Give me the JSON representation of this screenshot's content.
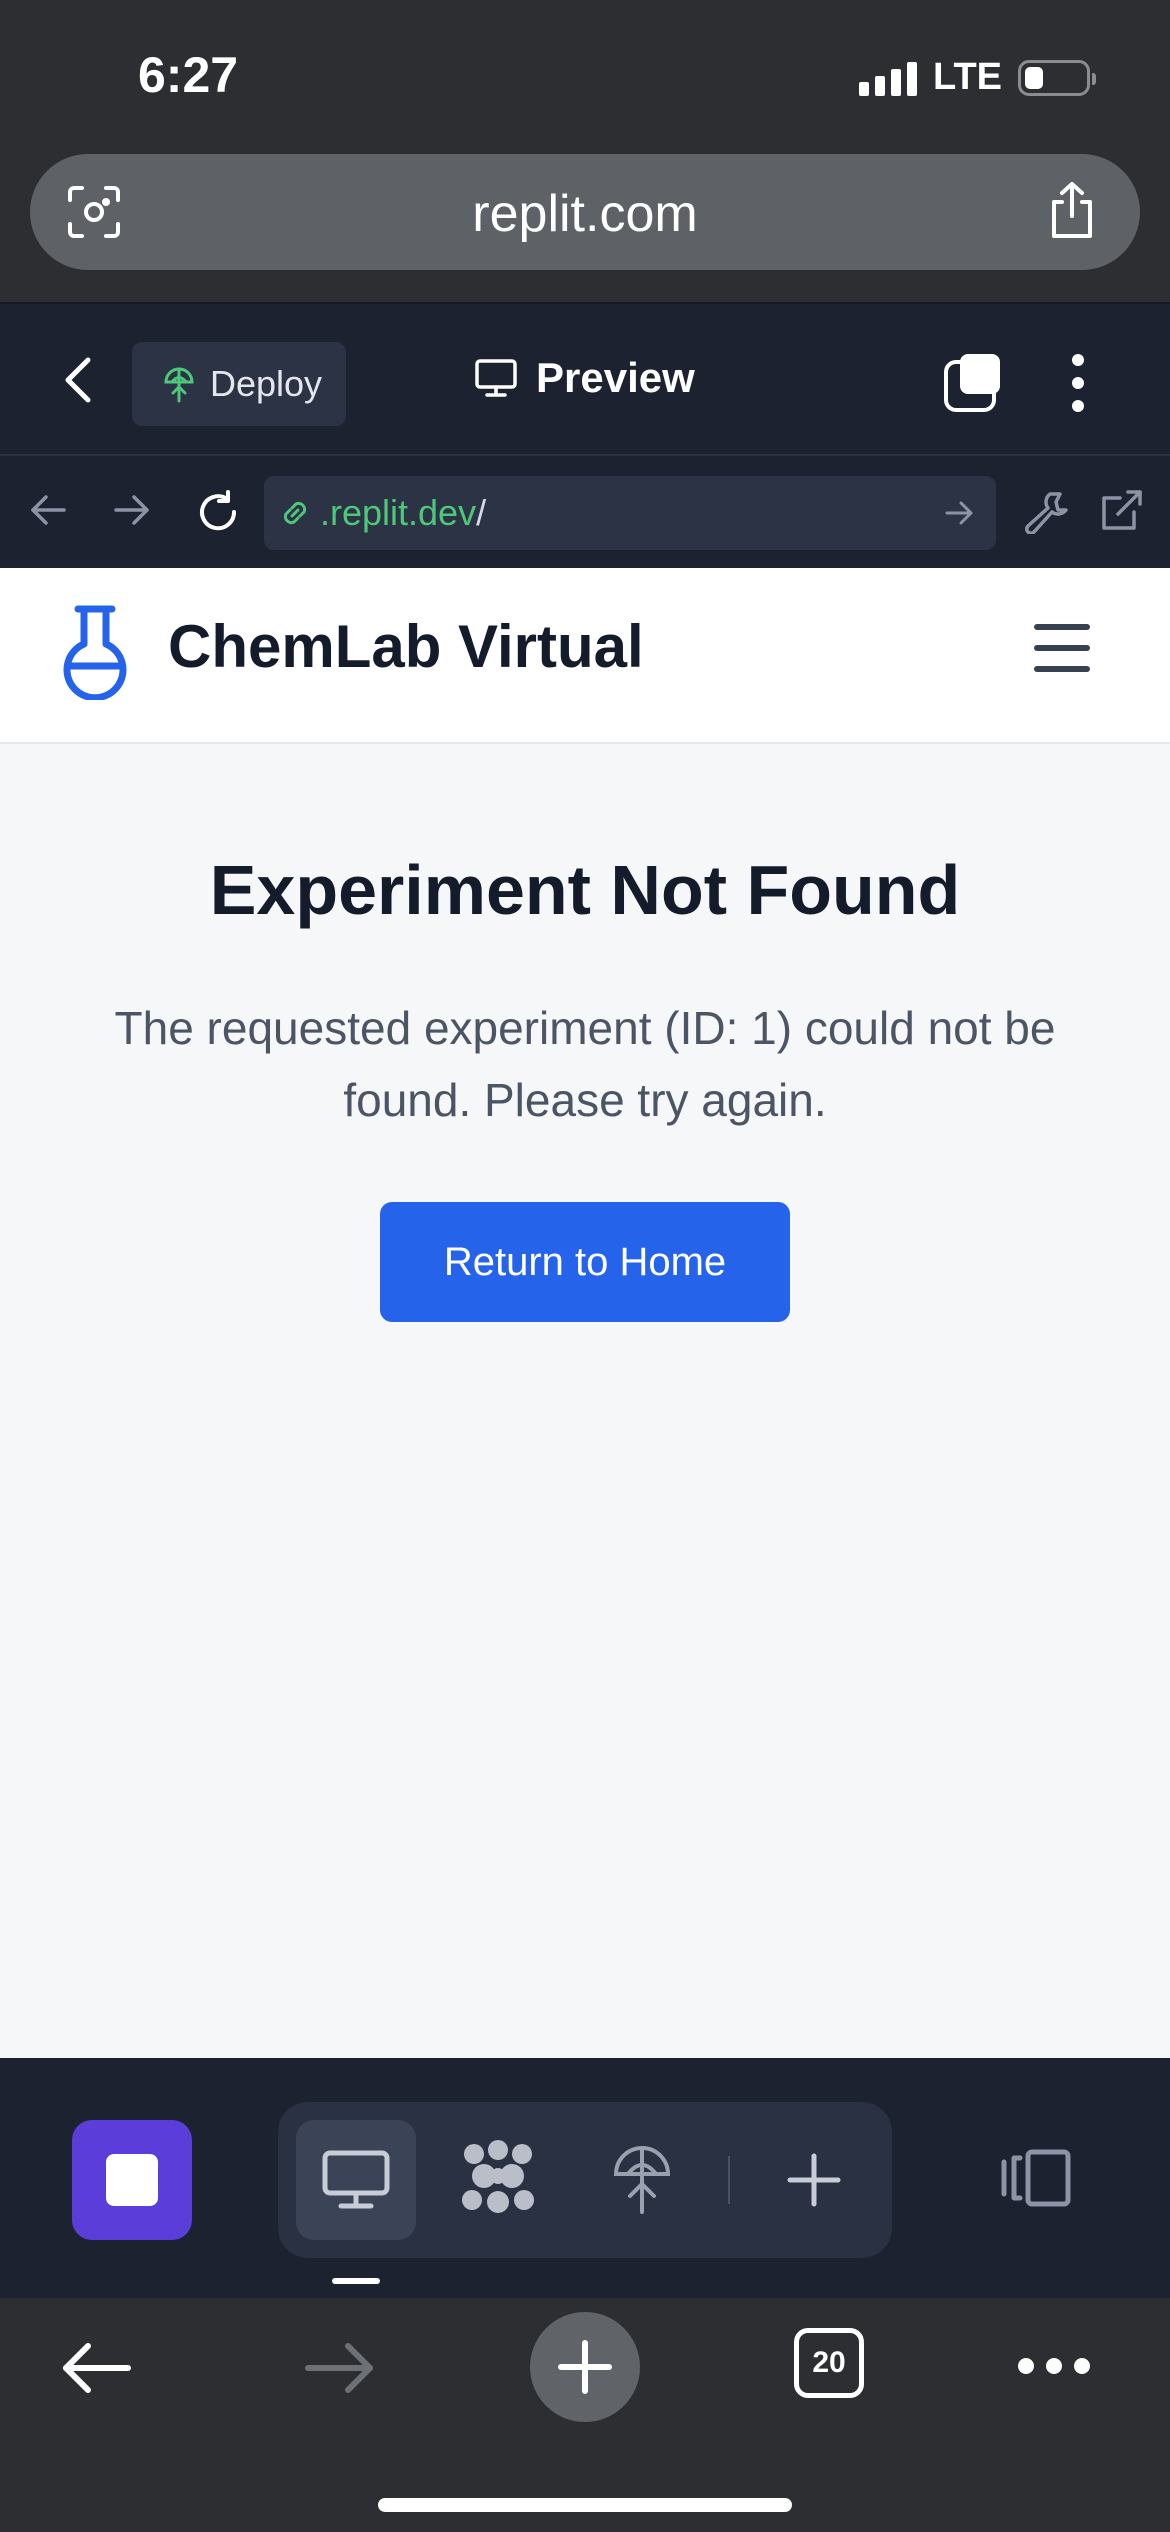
{
  "status_bar": {
    "time": "6:27",
    "network": "LTE",
    "battery_level": 0.2
  },
  "browser": {
    "url": "replit.com",
    "tab_count": "20"
  },
  "replit": {
    "deploy_label": "Deploy",
    "preview_label": "Preview",
    "url_domain": ".replit.dev",
    "url_path": "/"
  },
  "app": {
    "brand": "ChemLab Virtual"
  },
  "error": {
    "title": "Experiment Not Found",
    "message": "The requested experiment (ID: 1) could not be found. Please try again.",
    "button_label": "Return to Home"
  },
  "colors": {
    "accent": "#2563eb",
    "replit_bg": "#1c2230",
    "stop_button": "#5b3dd9",
    "url_green": "#4ec77b"
  },
  "icons": {
    "pill_left": "screenshot-camera-icon",
    "pill_right": "share-icon",
    "toolbar": [
      "chevron-left-icon",
      "deploy-icon",
      "monitor-icon",
      "tabs-icon",
      "kebab-menu-icon"
    ],
    "url_row": [
      "arrow-left-icon",
      "arrow-right-icon",
      "reload-icon",
      "link-icon",
      "go-arrow-icon",
      "wrench-icon",
      "external-link-icon"
    ],
    "bottom_tools": [
      "stop-icon",
      "monitor-icon",
      "agent-icon",
      "deploy-icon",
      "plus-icon",
      "layout-icon"
    ],
    "safari_bottom": [
      "back-arrow-icon",
      "forward-arrow-icon",
      "new-tab-plus-icon",
      "tab-count-icon",
      "more-dots-icon"
    ]
  }
}
